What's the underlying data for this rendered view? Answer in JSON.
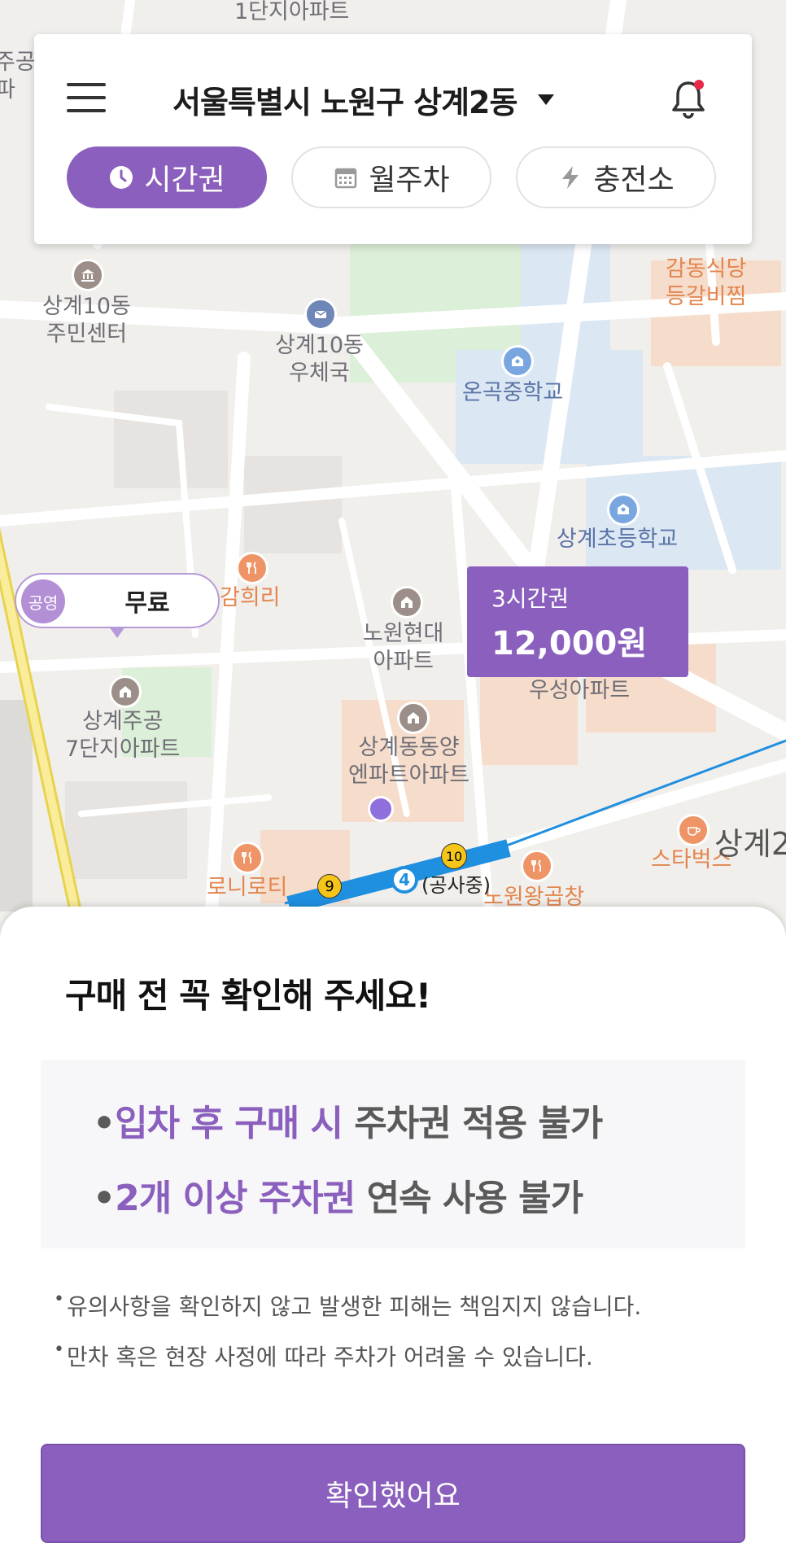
{
  "header": {
    "location": "서울특별시 노원구 상계2동",
    "tabs": [
      {
        "label": "시간권",
        "icon": "clock-icon",
        "active": true
      },
      {
        "label": "월주차",
        "icon": "calendar-icon",
        "active": false
      },
      {
        "label": "충전소",
        "icon": "lightning-icon",
        "active": false
      }
    ]
  },
  "map": {
    "labels": {
      "apt1": "1단지아파트",
      "left_edge": "주공\n파",
      "community_center": "상계10동\n주민센터",
      "post_office": "상계10동\n우체국",
      "middle_school": "온곡중학교",
      "restaurant1": "감동식당\n등갈비찜",
      "elementary": "상계초등학교",
      "restaurant2": "감희리",
      "hyundai_apt": "노원현대\n아파트",
      "wooseong_apt": "우성아파트",
      "jugong7": "상계주공\n7단지아파트",
      "dongyang_apt": "상계동동양\n엔파트아파트",
      "roniroti": "로니로티",
      "starbucks": "스타벅스",
      "nowon_gopchang": "노원왕곱창",
      "sanggye2": "상계2",
      "construction": "(공사중)",
      "station_num": "4",
      "exit9": "9",
      "exit10": "10"
    },
    "free_marker": {
      "badge": "공영",
      "label": "무료"
    },
    "price_marker": {
      "title": "3시간권",
      "price": "12,000원"
    }
  },
  "sheet": {
    "title": "구매 전 꼭 확인해 주세요!",
    "notice1": {
      "bullet": "•",
      "highlight": "입차 후 구매 시",
      "rest": " 주차권 적용 불가"
    },
    "notice2": {
      "bullet": "•",
      "highlight": "2개 이상 주차권",
      "rest": " 연속 사용 불가"
    },
    "notes": [
      "유의사항을 확인하지 않고 발생한 피해는 책임지지 않습니다.",
      "만차 혹은 현장 사정에 따라 주차가 어려울 수 있습니다."
    ],
    "confirm_label": "확인했어요"
  },
  "colors": {
    "accent": "#8a5fbd",
    "notification_dot": "#e8294b",
    "subway_line": "#1f8fe0"
  }
}
